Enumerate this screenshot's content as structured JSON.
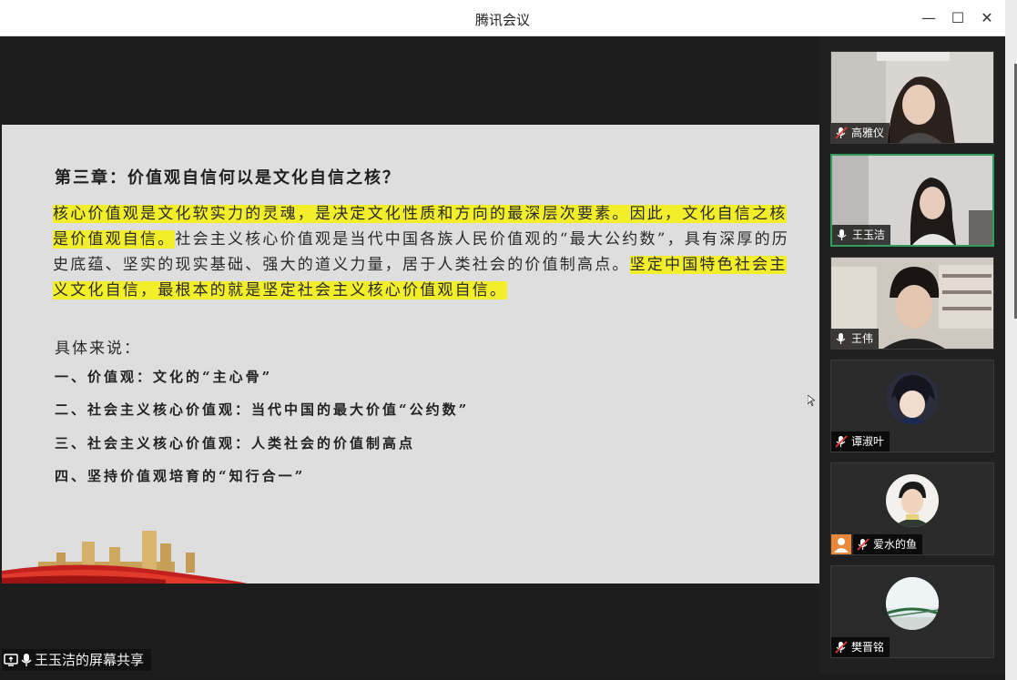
{
  "window": {
    "title": "腾讯会议",
    "minimize_label": "—",
    "maximize_label": "☐",
    "close_label": "✕"
  },
  "slide": {
    "heading": "第三章：价值观自信何以是文化自信之核？",
    "para_hl1": "核心价值观是文化软实力的灵魂，是决定文化性质和方向的最深层次要素。因此，文化自信之核是价值观自信。",
    "para_plain": "社会主义核心价值观是当代中国各族人民价值观的“最大公约数”，具有深厚的历史底蕴、坚实的现实基础、强大的道义力量，居于人类社会的价值制高点。",
    "para_hl2": "坚定中国特色社会主义文化自信，最根本的就是坚定社会主义核心价值观自信。",
    "intro": "具体来说：",
    "points": [
      "一、价值观：文化的“主心骨”",
      "二、社会主义核心价值观：当代中国的最大价值“公约数”",
      "三、社会主义核心价值观：人类社会的价值制高点",
      "四、坚持价值观培育的“知行合一”"
    ]
  },
  "share_label": "王玉洁的屏幕共享",
  "participants": [
    {
      "name": "高雅仪",
      "mic": "muted",
      "video": true
    },
    {
      "name": "王玉洁",
      "mic": "on",
      "video": true,
      "active": true
    },
    {
      "name": "王伟",
      "mic": "on",
      "video": true
    },
    {
      "name": "谭淑叶",
      "mic": "muted",
      "video": false
    },
    {
      "name": "爱水的鱼",
      "mic": "muted",
      "video": false
    },
    {
      "name": "樊晋铭",
      "mic": "muted",
      "video": false
    }
  ],
  "colors": {
    "highlight": "#f2ee2a",
    "active_border": "#2f9f5c",
    "mute_red": "#e53935"
  }
}
